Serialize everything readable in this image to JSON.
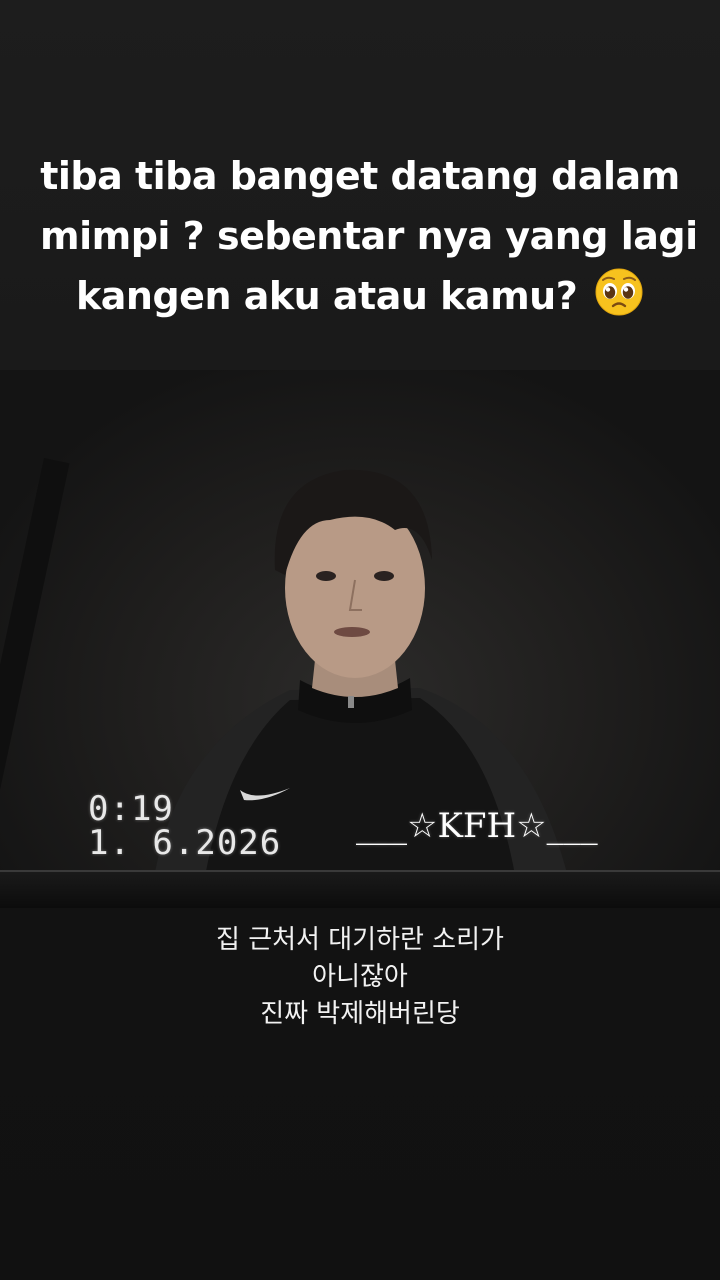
{
  "caption": {
    "line1": "tiba tiba banget datang dalam",
    "line2": "mimpi ? sebentar nya yang lagi",
    "line3": "kangen aku atau kamu?",
    "emoji": "pleading-face-emoji"
  },
  "video": {
    "timestamp_time": "0:19",
    "timestamp_date": "1. 6.2026",
    "watermark": "___☆KFH☆___"
  },
  "subtitle": {
    "line1": "집 근처서 대기하란 소리가",
    "line2": "아니잖아",
    "line3": "진짜 박제해버린당"
  },
  "colors": {
    "background": "#151515",
    "text": "#ffffff",
    "emoji_face": "#f7c21e"
  }
}
